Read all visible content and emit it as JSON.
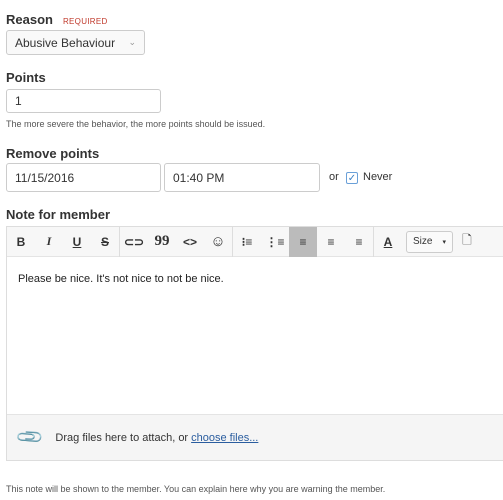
{
  "reason": {
    "label": "Reason",
    "required": "REQUIRED",
    "value": "Abusive Behaviour"
  },
  "points": {
    "label": "Points",
    "value": "1",
    "help": "The more severe the behavior, the more points should be issued."
  },
  "remove": {
    "label": "Remove points",
    "date": "11/15/2016",
    "time": "01:40 PM",
    "or": "or",
    "never_label": "Never",
    "never_checked": true
  },
  "note": {
    "label": "Note for member",
    "content": "Please be nice. It's not nice to not be nice.",
    "size_label": "Size",
    "attach_text": "Drag files here to attach, or ",
    "attach_link": "choose files...",
    "help": "This note will be shown to the member. You can explain here why you are warning the member."
  },
  "toolbar": {
    "bold": "B",
    "italic": "I",
    "underline": "U",
    "strike": "S",
    "quote": "99",
    "code": "<>",
    "emoji": "☺",
    "font_color": "A",
    "active": "align-left"
  },
  "colors": {
    "link": "#2a5d9f",
    "required": "#c0392b",
    "checkbox": "#3b7fc4"
  }
}
